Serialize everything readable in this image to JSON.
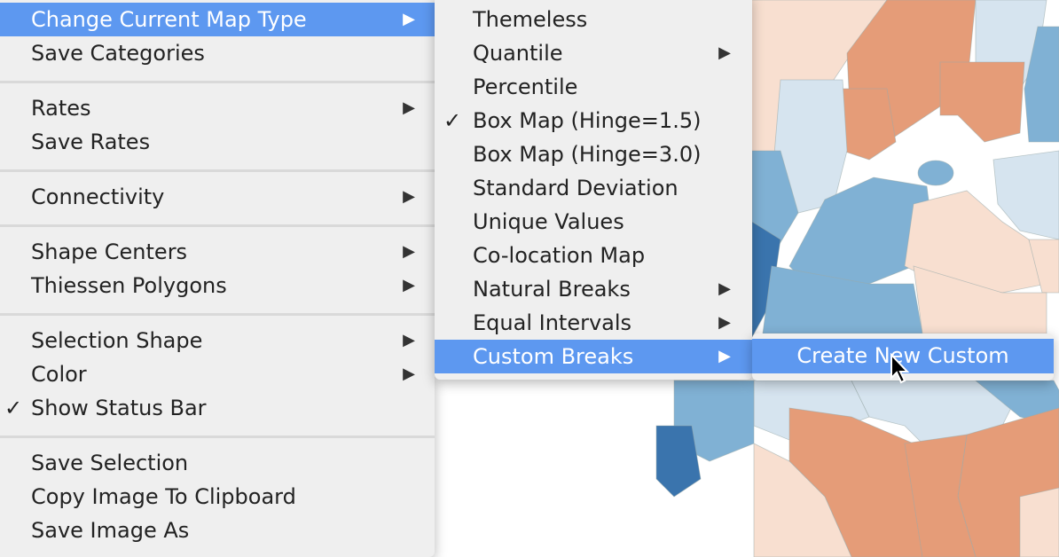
{
  "colors": {
    "highlight": "#5d98f0",
    "menu_bg": "#efefef",
    "map_dark_orange": "#e59c78",
    "map_light_orange": "#f8dfd0",
    "map_light_blue": "#d6e4ef",
    "map_mid_blue": "#80b1d4",
    "map_dark_blue": "#3a74ad"
  },
  "main_menu": {
    "items": [
      {
        "label": "Change Current Map Type",
        "submenu": true,
        "highlighted": true
      },
      {
        "label": "Save Categories"
      },
      {
        "label": "Rates",
        "submenu": true
      },
      {
        "label": "Save Rates"
      },
      {
        "label": "Connectivity",
        "submenu": true
      },
      {
        "label": "Shape Centers",
        "submenu": true
      },
      {
        "label": "Thiessen Polygons",
        "submenu": true
      },
      {
        "label": "Selection Shape",
        "submenu": true
      },
      {
        "label": "Color",
        "submenu": true
      },
      {
        "label": "Show Status Bar",
        "checked": true
      },
      {
        "label": "Save Selection"
      },
      {
        "label": "Copy Image To Clipboard"
      },
      {
        "label": "Save Image As"
      }
    ]
  },
  "map_type_menu": {
    "items": [
      {
        "label": "Themeless"
      },
      {
        "label": "Quantile",
        "submenu": true
      },
      {
        "label": "Percentile"
      },
      {
        "label": "Box Map (Hinge=1.5)",
        "checked": true
      },
      {
        "label": "Box Map (Hinge=3.0)"
      },
      {
        "label": "Standard Deviation"
      },
      {
        "label": "Unique Values"
      },
      {
        "label": "Co-location Map"
      },
      {
        "label": "Natural Breaks",
        "submenu": true
      },
      {
        "label": "Equal Intervals",
        "submenu": true
      },
      {
        "label": "Custom Breaks",
        "submenu": true,
        "highlighted": true
      }
    ]
  },
  "custom_breaks_menu": {
    "items": [
      {
        "label": "Create New Custom",
        "highlighted": true
      }
    ]
  },
  "symbols": {
    "check": "✓",
    "arrow": "▶"
  }
}
